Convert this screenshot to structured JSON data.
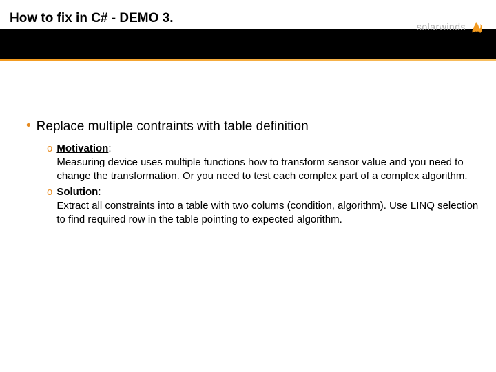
{
  "header": {
    "title": "How to fix in C# - DEMO 3.",
    "logo_text": "solarwinds"
  },
  "content": {
    "main_point": "Replace multiple contraints with table definition",
    "bullet_glyph": "•",
    "open_bullet_glyph": "o",
    "motivation_label": "Motivation",
    "motivation_body": "Measuring device uses multiple functions how to transform sensor value and you need to change the transformation. Or you need to test each complex part of a complex algorithm.",
    "solution_label": "Solution",
    "solution_body": "Extract all constraints into a table with two colums (condition, algorithm). Use LINQ selection to find required row in the table pointing to expected algorithm.",
    "colon": ":"
  }
}
